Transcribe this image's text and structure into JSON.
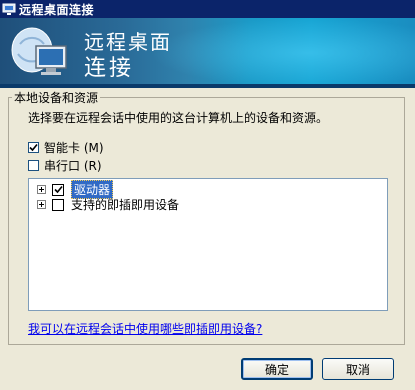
{
  "window": {
    "title": "远程桌面连接"
  },
  "banner": {
    "line1": "远程桌面",
    "line2": "连接"
  },
  "group": {
    "legend": "本地设备和资源",
    "description": "选择要在远程会话中使用的这台计算机上的设备和资源。"
  },
  "options": [
    {
      "label": "智能卡 (M)",
      "checked": true
    },
    {
      "label": "串行口 (R)",
      "checked": false
    }
  ],
  "tree": [
    {
      "label": "驱动器",
      "checked": true,
      "selected": true
    },
    {
      "label": "支持的即插即用设备",
      "checked": false,
      "selected": false
    }
  ],
  "help_link": "我可以在远程会话中使用哪些即插即用设备?",
  "buttons": {
    "ok": "确定",
    "cancel": "取消"
  },
  "icons": {
    "title": "computer-icon",
    "banner": "remote-desktop-icon"
  },
  "colors": {
    "titlebar": "#0b246a",
    "selection": "#316ac5",
    "link": "#0000ee"
  }
}
